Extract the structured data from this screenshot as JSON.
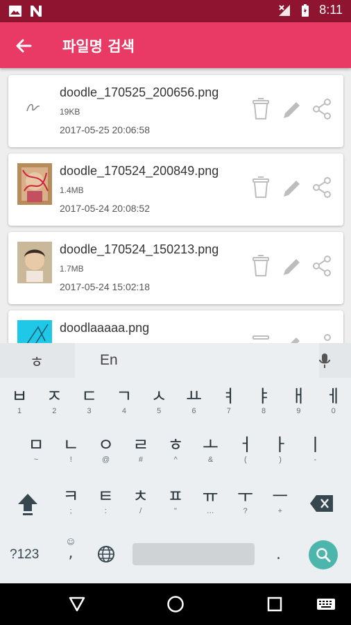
{
  "status_bar": {
    "time": "8:11",
    "icons": [
      "image-icon",
      "notification-n-icon",
      "signal-icon",
      "battery-icon"
    ]
  },
  "app_bar": {
    "title": "파일명 검색",
    "back_icon": "back-arrow-icon"
  },
  "files": [
    {
      "name": "doodle_170525_200656.png",
      "size": "19KB",
      "date": "2017-05-25 20:06:58"
    },
    {
      "name": "doodle_170524_200849.png",
      "size": "1.4MB",
      "date": "2017-05-24 20:08:52"
    },
    {
      "name": "doodle_170524_150213.png",
      "size": "1.7MB",
      "date": "2017-05-24 15:02:18"
    },
    {
      "name": "doodlaaaaa.png",
      "size": "",
      "date": ""
    }
  ],
  "keyboard": {
    "lang_switch": "ㅎ",
    "suggestion": "En",
    "row1": [
      {
        "k": "ㅂ",
        "s": "1"
      },
      {
        "k": "ㅈ",
        "s": "2"
      },
      {
        "k": "ㄷ",
        "s": "3"
      },
      {
        "k": "ㄱ",
        "s": "4"
      },
      {
        "k": "ㅅ",
        "s": "5"
      },
      {
        "k": "ㅛ",
        "s": "6"
      },
      {
        "k": "ㅕ",
        "s": "7"
      },
      {
        "k": "ㅑ",
        "s": "8"
      },
      {
        "k": "ㅐ",
        "s": "9"
      },
      {
        "k": "ㅔ",
        "s": "0"
      }
    ],
    "row2": [
      {
        "k": "ㅁ",
        "s": "~"
      },
      {
        "k": "ㄴ",
        "s": "!"
      },
      {
        "k": "ㅇ",
        "s": "@"
      },
      {
        "k": "ㄹ",
        "s": "#"
      },
      {
        "k": "ㅎ",
        "s": "^"
      },
      {
        "k": "ㅗ",
        "s": "&"
      },
      {
        "k": "ㅓ",
        "s": "("
      },
      {
        "k": "ㅏ",
        "s": ")"
      },
      {
        "k": "ㅣ",
        "s": "-"
      }
    ],
    "row3": [
      {
        "k": "ㅋ",
        "s": ";"
      },
      {
        "k": "ㅌ",
        "s": ":"
      },
      {
        "k": "ㅊ",
        "s": "/"
      },
      {
        "k": "ㅍ",
        "s": "\""
      },
      {
        "k": "ㅠ",
        "s": "…"
      },
      {
        "k": "ㅜ",
        "s": "?"
      },
      {
        "k": "ㅡ",
        "s": "+"
      }
    ],
    "symbols_label": "?123",
    "comma_label": ",",
    "period_label": ".",
    "accent_color": "#4db6ac"
  },
  "colors": {
    "status_bar": "#8e1430",
    "app_bar": "#e83a64",
    "icon_gray": "#bdbdbd"
  }
}
